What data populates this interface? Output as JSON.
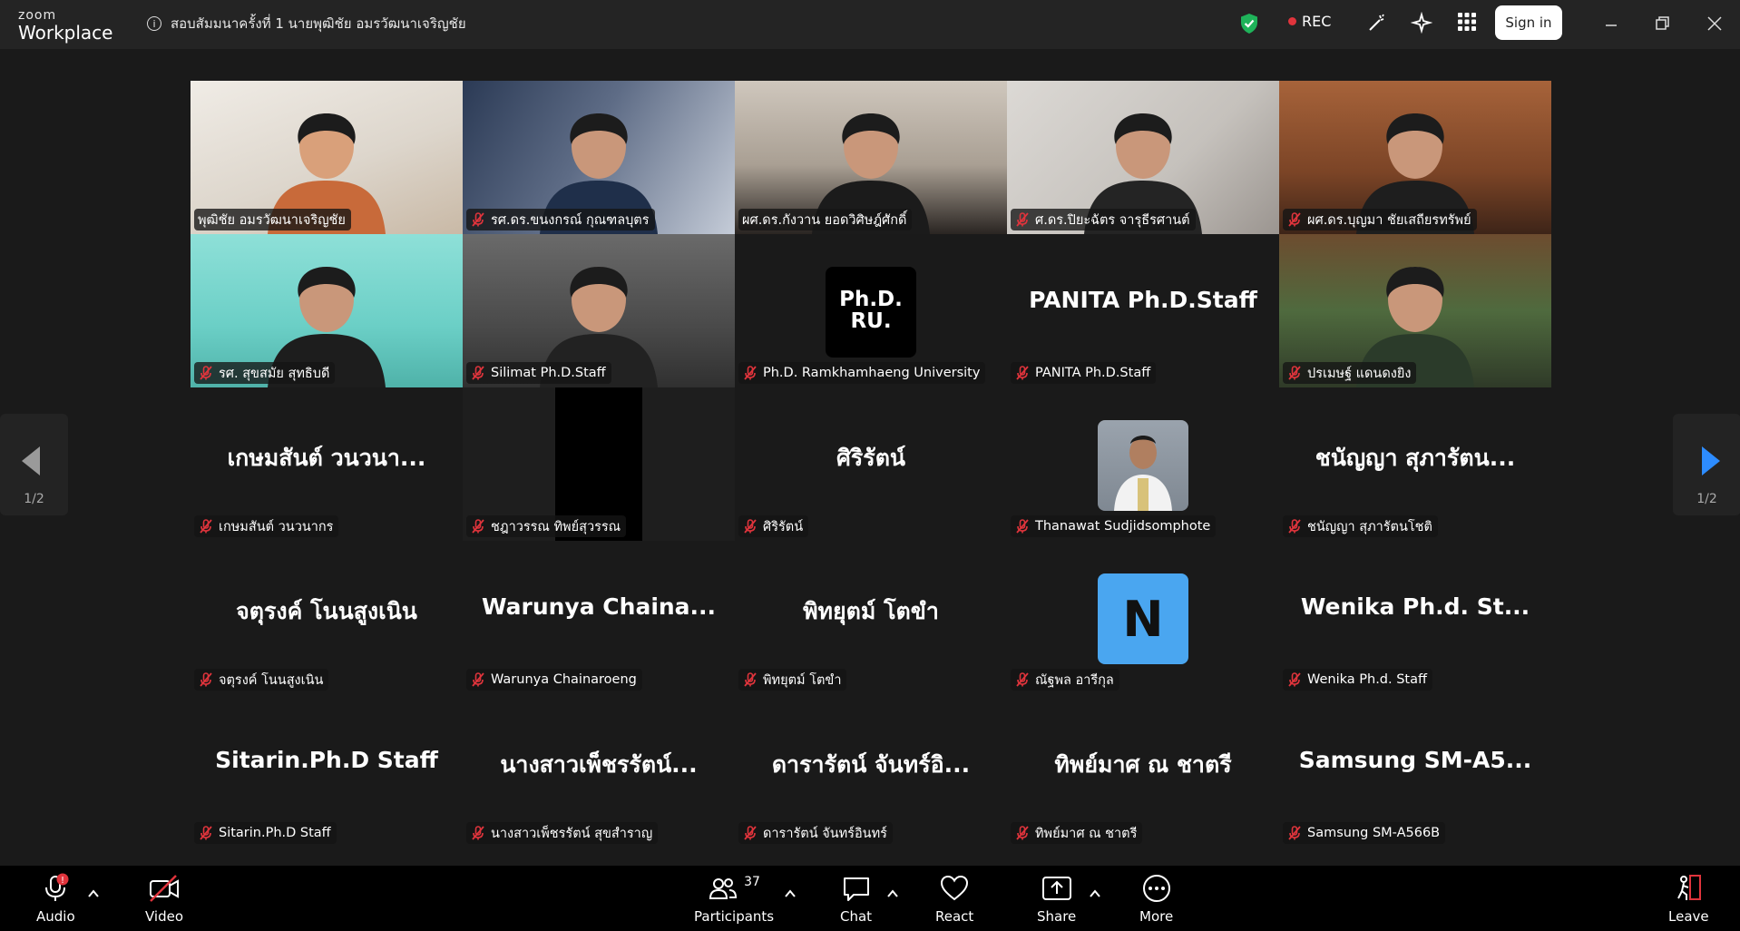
{
  "app": {
    "logo_small": "zoom",
    "logo_big": "Workplace"
  },
  "meeting": {
    "title": "สอบสัมมนาครั้งที่ 1  นายพุฒิชัย อมรวัฒนาเจริญชัย"
  },
  "header": {
    "rec_label": "REC",
    "signin_label": "Sign in"
  },
  "pager": {
    "left": "1/2",
    "right": "1/2"
  },
  "colors": {
    "accent_green": "#22d07a",
    "rec_red": "#e0343c",
    "mic_muted": "#e0343c",
    "avatar_blue": "#4aa6f0"
  },
  "tiles": [
    {
      "name": "พุฒิชัย อมรวัฒนาเจริญชัย",
      "kind": "video",
      "muted": false,
      "big": ""
    },
    {
      "name": "รศ.ดร.ขนงกรณ์ กุณฑลบุตร",
      "kind": "video",
      "muted": true,
      "big": ""
    },
    {
      "name": "ผศ.ดร.กังวาน ยอดวิศิษฎ์ศักดิ์",
      "kind": "video",
      "muted": false,
      "big": "",
      "active": true
    },
    {
      "name": "ศ.ดร.ปิยะฉัตร จารุธีรศานต์",
      "kind": "video",
      "muted": true,
      "big": ""
    },
    {
      "name": "ผศ.ดร.บุญมา ชัยเสถียรทรัพย์",
      "kind": "video",
      "muted": true,
      "big": ""
    },
    {
      "name": "รศ. สุขสมัย สุทธิบดี",
      "kind": "video",
      "muted": true,
      "big": ""
    },
    {
      "name": "Silimat Ph.D.Staff",
      "kind": "video",
      "muted": true,
      "big": ""
    },
    {
      "name": "Ph.D. Ramkhamhaeng University",
      "kind": "logo",
      "muted": true,
      "big": "Ph.D. RU."
    },
    {
      "name": "PANITA Ph.D.Staff",
      "kind": "text",
      "muted": true,
      "big": "PANITA Ph.D.Staff"
    },
    {
      "name": "ปรเมษฐ์ แดนดงยิง",
      "kind": "video",
      "muted": true,
      "big": ""
    },
    {
      "name": "เกษมสันต์ วนวนากร",
      "kind": "text",
      "muted": true,
      "big": "เกษมสันต์ วนวนา..."
    },
    {
      "name": "ชฎาวรรณ ทิพย์สุวรรณ",
      "kind": "dark",
      "muted": true,
      "big": ""
    },
    {
      "name": "ศิริรัตน์",
      "kind": "text",
      "muted": true,
      "big": "ศิริรัตน์"
    },
    {
      "name": "Thanawat Sudjidsomphote",
      "kind": "photo",
      "muted": true,
      "big": ""
    },
    {
      "name": "ชนัญญา สุภารัตนโชติ",
      "kind": "text",
      "muted": true,
      "big": "ชนัญญา สุภารัตน..."
    },
    {
      "name": "จตุรงค์ โนนสูงเนิน",
      "kind": "text",
      "muted": true,
      "big": "จตุรงค์ โนนสูงเนิน"
    },
    {
      "name": "Warunya Chainaroeng",
      "kind": "text",
      "muted": true,
      "big": "Warunya  Chaina..."
    },
    {
      "name": "พิทยุตม์ โตขำ",
      "kind": "text",
      "muted": true,
      "big": "พิทยุตม์ โตขำ"
    },
    {
      "name": "ณัฐพล อารีกุล",
      "kind": "letter",
      "muted": true,
      "big": "N"
    },
    {
      "name": "Wenika Ph.d. Staff",
      "kind": "text",
      "muted": true,
      "big": "Wenika Ph.d. St..."
    },
    {
      "name": "Sitarin.Ph.D Staff",
      "kind": "text",
      "muted": true,
      "big": "Sitarin.Ph.D Staff"
    },
    {
      "name": "นางสาวเพ็ชรรัตน์ สุขสำราญ",
      "kind": "text",
      "muted": true,
      "big": "นางสาวเพ็ชรรัตน์..."
    },
    {
      "name": "ดารารัตน์ จันทร์อินทร์",
      "kind": "text",
      "muted": true,
      "big": "ดารารัตน์ จันทร์อิ..."
    },
    {
      "name": "ทิพย์มาศ ณ ชาตรี",
      "kind": "text",
      "muted": true,
      "big": "ทิพย์มาศ ณ ชาตรี"
    },
    {
      "name": "Samsung SM-A566B",
      "kind": "text",
      "muted": true,
      "big": "Samsung  SM-A5..."
    }
  ],
  "toolbar": {
    "audio": "Audio",
    "audio_badge": "!",
    "video": "Video",
    "participants": "Participants",
    "participants_count": "37",
    "chat": "Chat",
    "react": "React",
    "share": "Share",
    "more": "More",
    "leave": "Leave"
  }
}
